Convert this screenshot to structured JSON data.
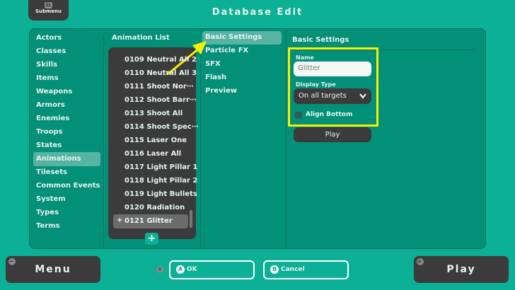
{
  "header": {
    "title": "Database Edit",
    "submenu_label": "Submenu",
    "submenu_key": "ZL"
  },
  "sidebar": {
    "items": [
      "Actors",
      "Classes",
      "Skills",
      "Items",
      "Weapons",
      "Armors",
      "Enemies",
      "Troops",
      "States",
      "Animations",
      "Tilesets",
      "Common Events",
      "System",
      "Types",
      "Terms"
    ],
    "selected": "Animations"
  },
  "animation_list": {
    "title": "Animation List",
    "items": [
      "0109 Neutral All 2",
      "0110 Neutral All 3",
      "0111 Shoot Nor⋯",
      "0112 Shoot Barr⋯",
      "0113 Shoot All",
      "0114 Shoot Spec⋯",
      "0115 Laser One",
      "0116 Laser All",
      "0117 Light Pillar 1",
      "0118 Light Pillar 2",
      "0119 Light Bullets",
      "0120 Radiation",
      "0121 Glitter"
    ],
    "selected": "0121 Glitter",
    "add_label": "+"
  },
  "tabs": {
    "items": [
      "Basic Settings",
      "Particle FX",
      "SFX",
      "Flash",
      "Preview"
    ],
    "selected": "Basic Settings"
  },
  "basic": {
    "title": "Basic Settings",
    "name_label": "Name",
    "name_value": "Glitter",
    "display_type_label": "Display Type",
    "display_type_value": "On all targets",
    "align_bottom_label": "Align Bottom",
    "align_bottom_checked": false,
    "play_label": "Play"
  },
  "footer": {
    "menu_label": "Menu",
    "ok_label": "OK",
    "ok_key": "A",
    "cancel_label": "Cancel",
    "cancel_key": "B",
    "x_key": "X",
    "play_label": "Play"
  },
  "colors": {
    "background": "#0bb096",
    "panel": "#029078",
    "dark": "#3b3b3b",
    "highlight": "#f5f000"
  }
}
